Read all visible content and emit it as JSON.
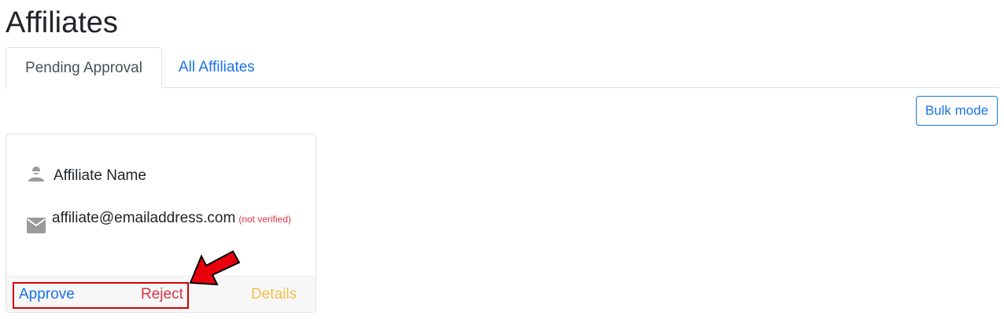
{
  "page": {
    "title": "Affiliates"
  },
  "tabs": [
    {
      "label": "Pending Approval",
      "active": true
    },
    {
      "label": "All Affiliates",
      "active": false
    }
  ],
  "toolbar": {
    "bulk_label": "Bulk mode"
  },
  "affiliate_card": {
    "name_icon": "user-icon",
    "name": "Affiliate Name",
    "email_icon": "mail-icon",
    "email": "affiliate@emailaddress.com",
    "verification_status": "(not verified)",
    "actions": {
      "approve": "Approve",
      "reject": "Reject",
      "details": "Details"
    }
  },
  "annotation": {
    "highlight_color": "#d40000",
    "arrow_fill": "#e8000b"
  },
  "colors": {
    "link": "#1a73e8",
    "danger": "#dc3545",
    "warning": "#f2c14e"
  }
}
